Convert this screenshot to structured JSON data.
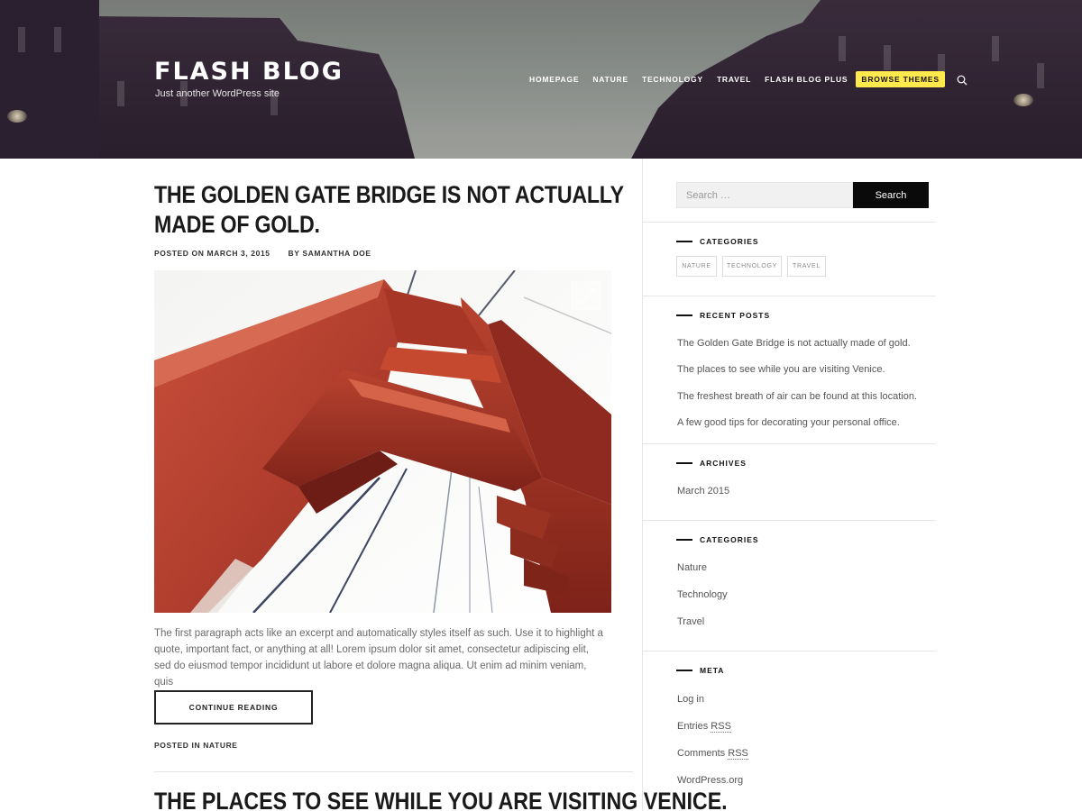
{
  "site": {
    "title": "FLASH BLOG",
    "tagline": "Just another WordPress site"
  },
  "nav": {
    "items": [
      "HOMEPAGE",
      "NATURE",
      "TECHNOLOGY",
      "TRAVEL",
      "FLASH BLOG PLUS"
    ],
    "cta": "BROWSE THEMES",
    "accent": "#ffe94d"
  },
  "post": {
    "title": "THE GOLDEN GATE BRIDGE IS NOT ACTUALLY MADE OF GOLD.",
    "posted_on_label": "POSTED ON",
    "date": "MARCH 3, 2015",
    "by_label": "BY",
    "author": "SAMANTHA DOE",
    "excerpt": "The first paragraph acts like an excerpt and automatically styles itself as such. Use it to highlight a quote, important fact, or anything at all! Lorem ipsum dolor sit amet, consectetur adipiscing elit, sed do eiusmod tempor incididunt ut labore et dolore magna aliqua. Ut enim ad minim veniam, quis",
    "continue_label": "CONTINUE READING",
    "posted_in_label": "POSTED IN",
    "category": "NATURE"
  },
  "next_post": {
    "title": "THE PLACES TO SEE WHILE YOU ARE VISITING VENICE."
  },
  "sidebar": {
    "search": {
      "placeholder": "Search …",
      "button": "Search"
    },
    "categories_tags": {
      "title": "CATEGORIES",
      "tags": [
        "NATURE",
        "TECHNOLOGY",
        "TRAVEL"
      ]
    },
    "recent_posts": {
      "title": "RECENT POSTS",
      "items": [
        "The Golden Gate Bridge is not actually made of gold.",
        "The places to see while you are visiting Venice.",
        "The freshest breath of air can be found at this location.",
        "A few good tips for decorating your personal office."
      ]
    },
    "archives": {
      "title": "ARCHIVES",
      "items": [
        "March 2015"
      ]
    },
    "categories": {
      "title": "CATEGORIES",
      "items": [
        "Nature",
        "Technology",
        "Travel"
      ]
    },
    "meta": {
      "title": "META",
      "login": "Log in",
      "entries_prefix": "Entries ",
      "comments_prefix": "Comments ",
      "rss": "RSS",
      "wordpress": "WordPress.org"
    }
  }
}
